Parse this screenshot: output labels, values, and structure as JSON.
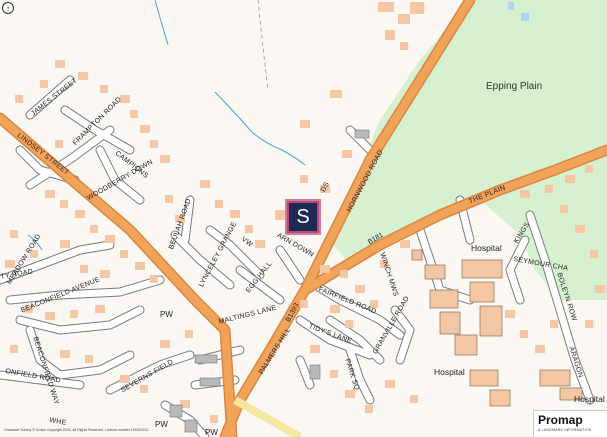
{
  "map": {
    "labels": {
      "area": "Epping Plain",
      "site_marker": "S",
      "streets": {
        "james_street": "JAMES STREET",
        "lindsey_street": "LINDSEY STREET",
        "frampton_road": "FRAMPTON ROAD",
        "campions": "CAMPIONS",
        "woodberry_down": "WOODBERRY DOWN",
        "beulah_road": "BEULAH ROAD",
        "lynceley_grange": "LYNCELEY GRANGE",
        "meadow_road": "MEADOW ROAD",
        "beaconfield_avenue": "BEACONFIELD AVENUE",
        "beaconfield_way": "BEACONFIELD WAY",
        "beaconfield_road": "ONFIELD ROAD",
        "egg_hall": "EGG HALL",
        "meadow_vw": "MEADOW VW",
        "maltings_lane": "MALTINGS LANE",
        "palmers_hill": "PALMERS HILL",
        "tidys_lane": "TIDY'S LANE",
        "fairfield_road": "FAIRFIELD ROAD",
        "granville_road": "GRANVILLE ROAD",
        "park_sq": "PARK SQ",
        "severns_field": "SEVERNS FIELD",
        "hornwood_road": "HORNWOOD ROAD",
        "the_plain": "THE PLAIN",
        "winch_mews": "WINCH MWS",
        "kings": "KINGS",
        "seymour_cha": "SEYMOUR CHA",
        "boleyn_row": "BOLEYN ROW",
        "aragon": "ARAGON",
        "ty_road": "TY ROAD",
        "whe": "WHE",
        "vw": "VW",
        "ds": "DS",
        "sdown": "ARN DOWN"
      },
      "road_numbers": {
        "b181": "B181",
        "b1393": "B1393"
      },
      "pois": {
        "pw_1": "PW",
        "pw_2": "PW",
        "pw_3": "PW",
        "hospital_1": "Hospital",
        "hospital_2": "Hospital",
        "hospital_3": "Hospital"
      }
    },
    "logo": {
      "name": "Promap",
      "tagline": "A LANDMARK INFORMATION"
    },
    "copyright": "Ordnance Survey © Crown Copyright 2023. All Rights Reserved. Licence number 100022432",
    "colors": {
      "background": "#fbf7f2",
      "woodland": "#d6f0d0",
      "main_road": "#f2a35a",
      "main_road_casing": "#d9863e",
      "minor_road": "#ffffff",
      "minor_road_casing": "#7a7a7a",
      "building": "#f6c7a6",
      "water": "#4aa3d8",
      "marker_outer": "#b94878",
      "marker_inner": "#1e2a55"
    }
  }
}
